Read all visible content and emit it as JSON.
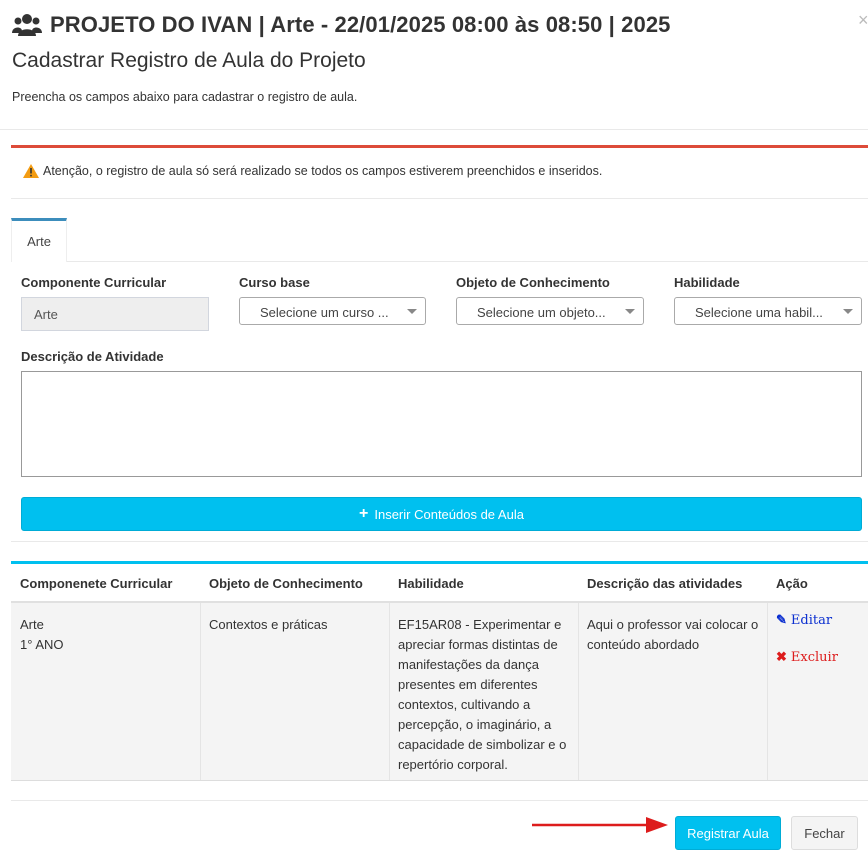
{
  "header": {
    "title": "PROJETO DO IVAN | Arte - 22/01/2025 08:00 às 08:50 | 2025",
    "subtitle": "Cadastrar Registro de Aula do Projeto",
    "help_text": "Preencha os campos abaixo para cadastrar o registro de aula.",
    "title_icon": "users-icon",
    "close_icon": "close-icon"
  },
  "alert": {
    "icon": "warning-icon",
    "text": "Atenção, o registro de aula só será realizado se todos os campos estiverem preenchidos e inseridos."
  },
  "tabs": [
    {
      "label": "Arte",
      "active": true
    }
  ],
  "form": {
    "componente_label": "Componente Curricular",
    "componente_value": "Arte",
    "curso_label": "Curso base",
    "curso_placeholder": "Selecione um curso ...",
    "objeto_label": "Objeto de Conhecimento",
    "objeto_placeholder": "Selecione um objeto...",
    "habilidade_label": "Habilidade",
    "habilidade_placeholder": "Selecione uma habil...",
    "descricao_label": "Descrição de Atividade",
    "descricao_value": "",
    "insert_button": "Inserir Conteúdos de Aula"
  },
  "table": {
    "headers": [
      "Componenete Curricular",
      "Objeto de Conhecimento",
      "Habilidade",
      "Descrição das atividades",
      "Ação"
    ],
    "rows": [
      {
        "componente": "Arte",
        "ano": "1° ANO",
        "objeto": "Contextos e práticas",
        "habilidade": "EF15AR08 - Experimentar e apreciar formas distintas de manifestações da dança presentes em diferentes contextos, cultivando a percepção, o imaginário, a capacidade de simbolizar e o repertório corporal.",
        "descricao": "Aqui o professor vai colocar o conteúdo abordado",
        "edit_label": "Editar",
        "delete_label": "Excluir"
      }
    ]
  },
  "footer": {
    "register_button": "Registrar Aula",
    "close_button": "Fechar"
  },
  "colors": {
    "accent": "#00c0ef",
    "alert_border": "#dd4b39",
    "tab_border": "#3c8dbc",
    "arrow": "#dd1c1c"
  }
}
